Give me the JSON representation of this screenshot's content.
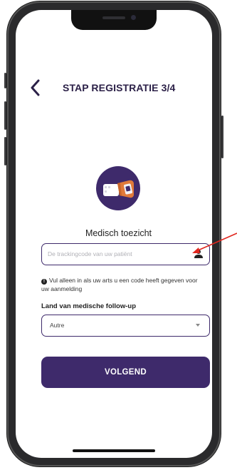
{
  "header": {
    "title": "STAP REGISTRATIE 3/4",
    "back_icon": "chevron-left-icon"
  },
  "illustration": {
    "icon": "medical-monitor-hand-icon",
    "bg_color": "#3e2a6b"
  },
  "section": {
    "title": "Medisch toezicht"
  },
  "tracking_input": {
    "placeholder": "De trackingcode van uw patiënt",
    "value": "",
    "icon": "user-icon"
  },
  "info": {
    "icon": "info-icon",
    "text": "Vul alleen in als uw arts u een code heeft gegeven voor uw aanmelding"
  },
  "country": {
    "label": "Land van medische follow-up",
    "selected": "Autre",
    "caret_icon": "caret-down-icon"
  },
  "actions": {
    "next_label": "VOLGEND"
  },
  "colors": {
    "primary": "#3e2a6b",
    "accent_orange": "#e07a3a",
    "annotation": "#e0261e"
  }
}
